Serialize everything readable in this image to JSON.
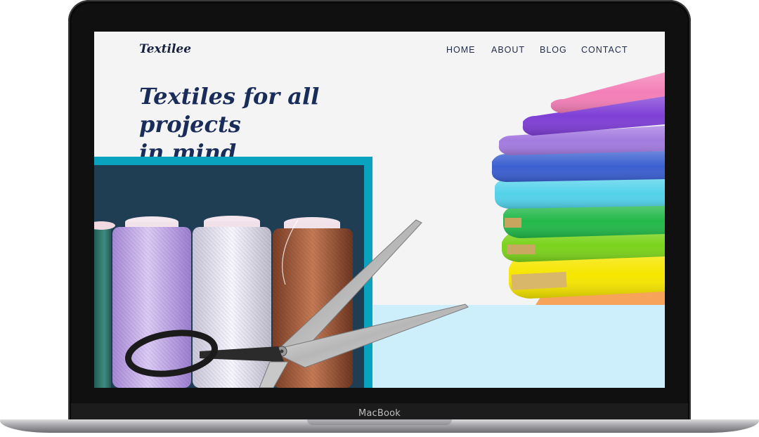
{
  "device": {
    "brand_label": "MacBook"
  },
  "site": {
    "logo": "Textilee",
    "nav": [
      {
        "label": "HOME"
      },
      {
        "label": "ABOUT"
      },
      {
        "label": "BLOG"
      },
      {
        "label": "CONTACT"
      }
    ],
    "headline_line1": "Textiles for all projects",
    "headline_line2": "in mind"
  },
  "colors": {
    "navy_text": "#1a2d5a",
    "teal_frame": "#0aa3bf",
    "panel_dark": "#1f3e53",
    "panel_light_blue": "#cdeefb",
    "page_bg": "#f4f4f4"
  },
  "images": [
    {
      "name": "thread-spools-and-scissors-photo"
    },
    {
      "name": "fabric-rolls-stack-photo"
    }
  ]
}
